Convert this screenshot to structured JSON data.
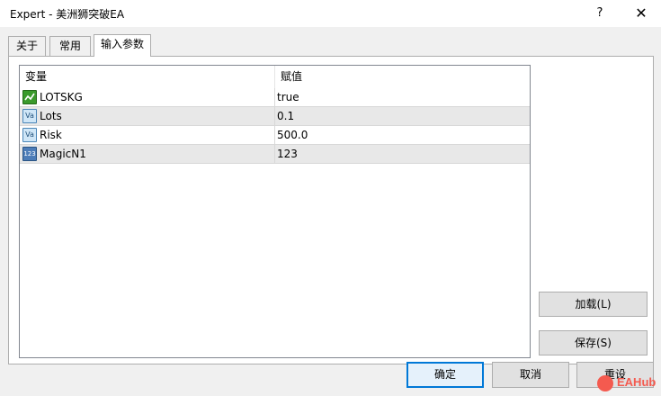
{
  "window": {
    "title": "Expert - 美洲狮突破EA",
    "help": "?",
    "close": "✕"
  },
  "tabs": [
    {
      "label": "关于"
    },
    {
      "label": "常用"
    },
    {
      "label": "输入参数"
    }
  ],
  "grid": {
    "headers": {
      "variable": "变量",
      "value": "赋值"
    },
    "rows": [
      {
        "name": "LOTSKG",
        "value": "true",
        "icon": "bool-icon"
      },
      {
        "name": "Lots",
        "value": "0.1",
        "icon": "double-icon"
      },
      {
        "name": "Risk",
        "value": "500.0",
        "icon": "double-icon"
      },
      {
        "name": "MagicN1",
        "value": "123",
        "icon": "int-icon"
      }
    ]
  },
  "buttons": {
    "load": "加载(L)",
    "save": "保存(S)",
    "ok": "确定",
    "cancel": "取消",
    "reset": "重设"
  },
  "watermark": {
    "text": "EAHub"
  }
}
